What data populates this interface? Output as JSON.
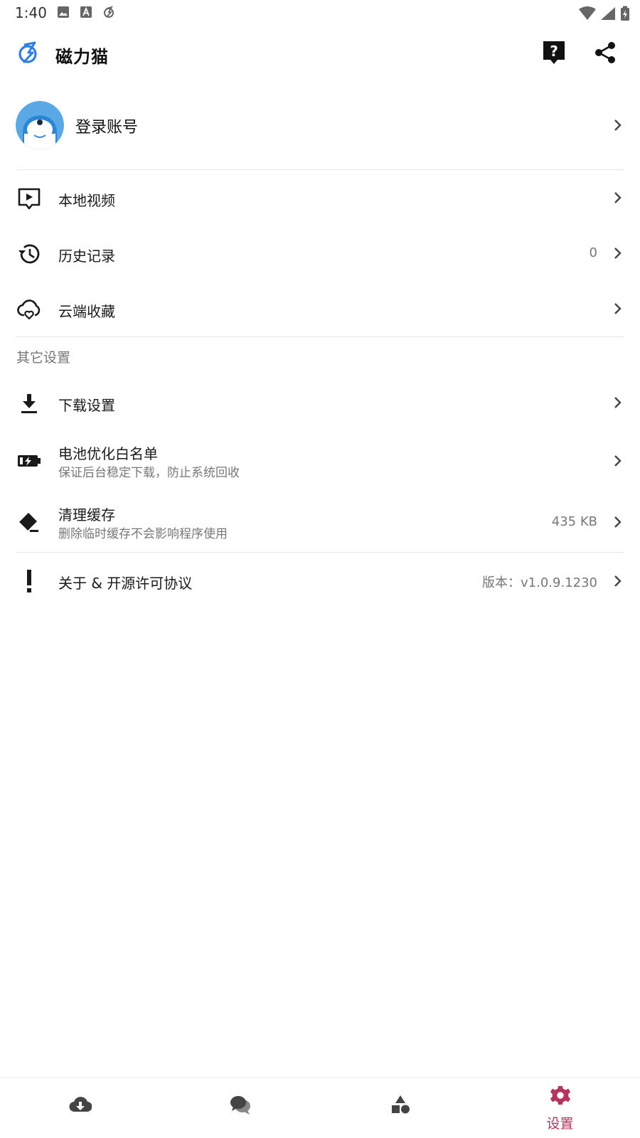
{
  "status_bar": {
    "time": "1:40"
  },
  "app": {
    "title": "磁力猫"
  },
  "account": {
    "label": "登录账号"
  },
  "menu_main": [
    {
      "title": "本地视频",
      "icon": "video-icon",
      "value": ""
    },
    {
      "title": "历史记录",
      "icon": "history-icon",
      "value": "0"
    },
    {
      "title": "云端收藏",
      "icon": "cloud-heart-icon",
      "value": ""
    }
  ],
  "section_other": {
    "header": "其它设置"
  },
  "menu_other": [
    {
      "title": "下载设置",
      "subtitle": "",
      "icon": "download-icon",
      "value": ""
    },
    {
      "title": "电池优化白名单",
      "subtitle": "保证后台稳定下载，防止系统回收",
      "icon": "battery-icon",
      "value": ""
    },
    {
      "title": "清理缓存",
      "subtitle": "删除临时缓存不会影响程序使用",
      "icon": "eraser-icon",
      "value": "435 KB"
    },
    {
      "title": "关于 & 开源许可协议",
      "subtitle": "",
      "icon": "exclamation-icon",
      "value": "版本：v1.0.9.1230"
    }
  ],
  "bottom_nav": {
    "items": [
      {
        "id": "download",
        "icon": "cloud-download-icon",
        "label": ""
      },
      {
        "id": "chat",
        "icon": "chat-icon",
        "label": ""
      },
      {
        "id": "discover",
        "icon": "shapes-icon",
        "label": ""
      },
      {
        "id": "settings",
        "icon": "gear-icon",
        "label": "设置",
        "active": true
      }
    ]
  },
  "colors": {
    "accent": "#b4345f",
    "logo_blue": "#2f7fe0",
    "text_primary": "#1a1a1a",
    "text_secondary": "#777777",
    "divider": "#e6e6e6"
  }
}
